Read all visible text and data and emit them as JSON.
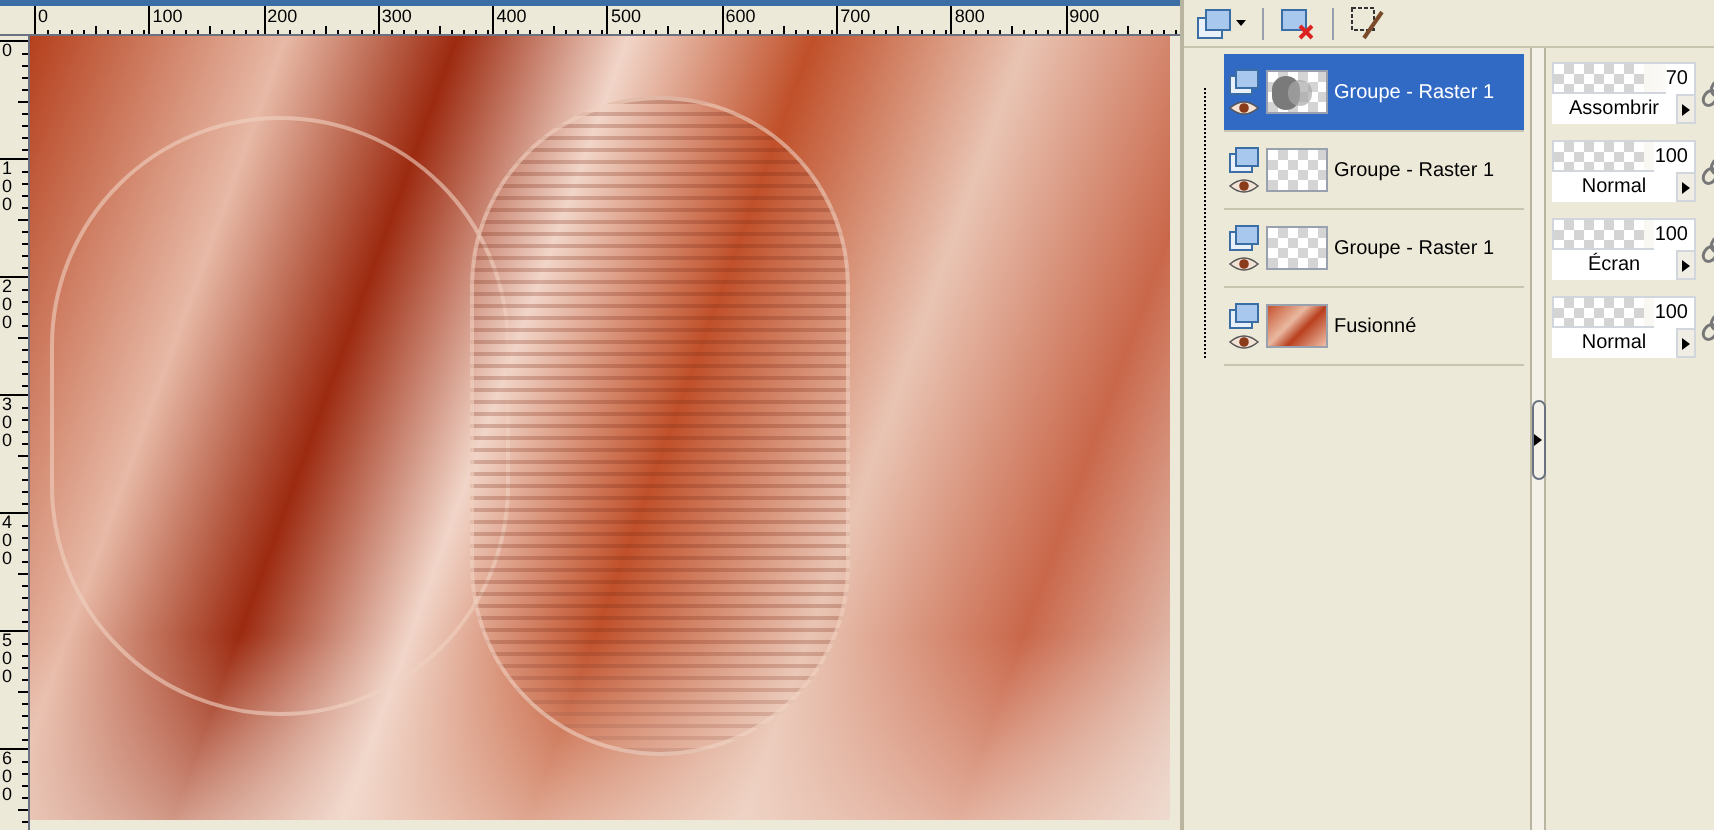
{
  "rulers": {
    "horizontal": [
      "0",
      "100",
      "200",
      "300",
      "400",
      "500",
      "600",
      "700",
      "800",
      "900"
    ],
    "vertical": [
      "0",
      "100",
      "200",
      "300",
      "400",
      "500",
      "600"
    ]
  },
  "layers": [
    {
      "name": "Groupe - Raster 1",
      "selected": true,
      "kind": "shape",
      "opacity": "70",
      "blend_mode": "Assombrir"
    },
    {
      "name": "Groupe - Raster 1",
      "selected": false,
      "kind": "empty",
      "opacity": "100",
      "blend_mode": "Normal"
    },
    {
      "name": "Groupe - Raster 1",
      "selected": false,
      "kind": "empty",
      "opacity": "100",
      "blend_mode": "Écran"
    },
    {
      "name": "Fusionné",
      "selected": false,
      "kind": "image",
      "opacity": "100",
      "blend_mode": "Normal"
    }
  ]
}
